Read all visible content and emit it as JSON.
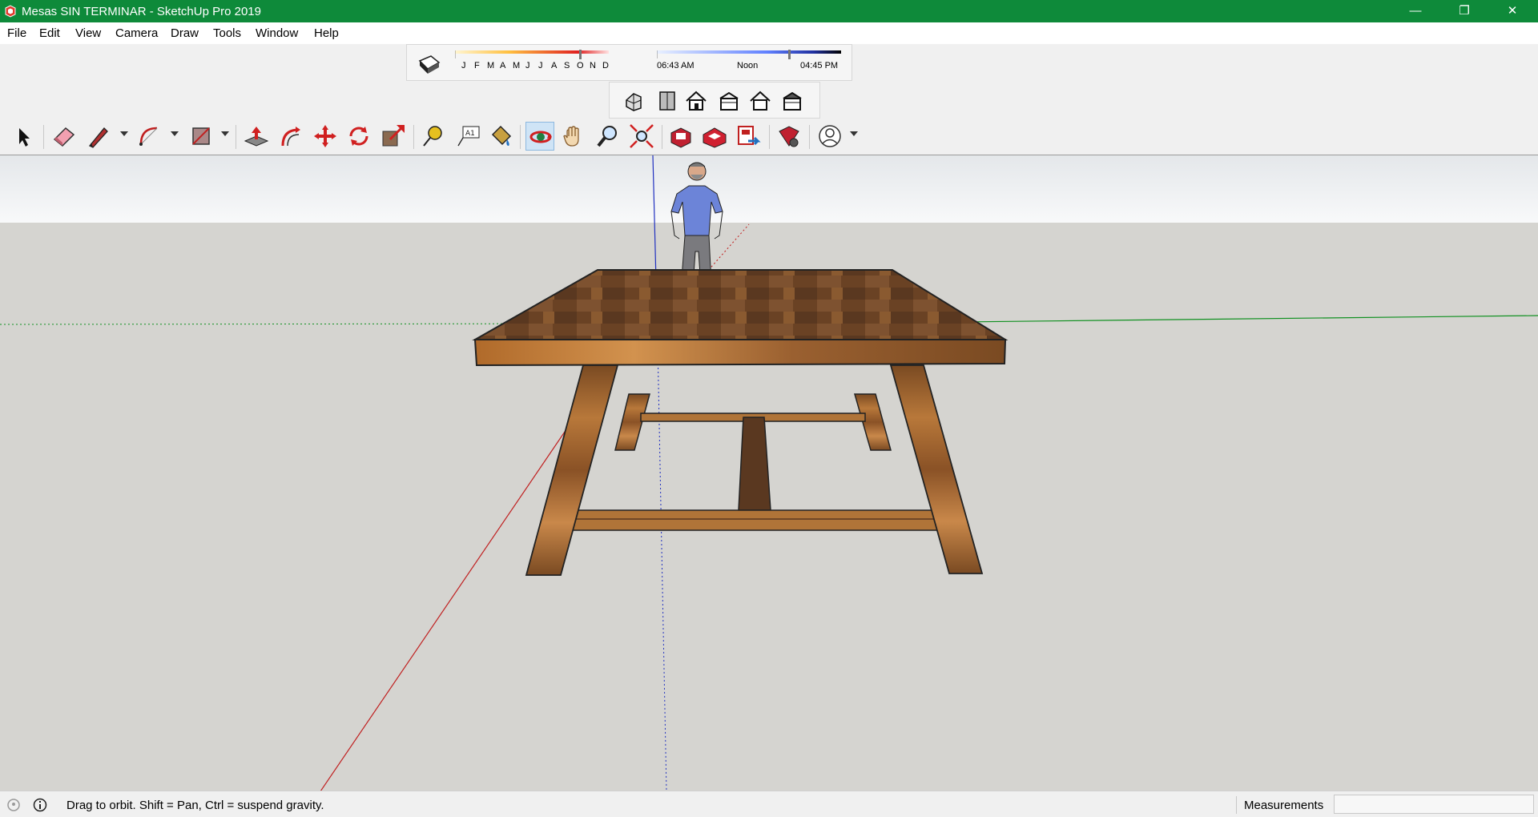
{
  "window": {
    "title": "Mesas SIN TERMINAR - SketchUp Pro 2019",
    "minimize_glyph": "—",
    "restore_glyph": "❐",
    "close_glyph": "✕"
  },
  "menu": {
    "items": [
      "File",
      "Edit",
      "View",
      "Camera",
      "Draw",
      "Tools",
      "Window",
      "Help"
    ]
  },
  "shadows": {
    "months": [
      "J",
      "F",
      "M",
      "A",
      "M",
      "J",
      "J",
      "A",
      "S",
      "O",
      "N",
      "D"
    ],
    "time_start": "06:43 AM",
    "time_mid": "Noon",
    "time_end": "04:45 PM"
  },
  "views_toolbar": {
    "icons": [
      "iso-view-icon",
      "top-view-icon",
      "front-view-icon",
      "right-view-icon",
      "back-view-icon",
      "left-view-icon"
    ]
  },
  "main_toolbar": {
    "tools": [
      "select-icon",
      "eraser-icon",
      "line-icon",
      "arc-icon",
      "rectangle-icon",
      "push-pull-icon",
      "offset-icon",
      "move-icon",
      "rotate-icon",
      "scale-icon",
      "tape-measure-icon",
      "text-icon",
      "paint-bucket-icon",
      "orbit-icon",
      "pan-icon",
      "zoom-icon",
      "zoom-extents-icon",
      "3d-warehouse-icon",
      "extension-warehouse-icon",
      "layout-icon",
      "extension-manager-icon",
      "account-icon"
    ],
    "active_tool": "orbit-icon"
  },
  "status": {
    "hint": "Drag to orbit. Shift = Pan, Ctrl = suspend gravity.",
    "measurements_label": "Measurements",
    "measurements_value": ""
  },
  "colors": {
    "titlebar": "#0e8a3a",
    "sky": "#f3f4f5",
    "ground": "#d5d4d0",
    "wood_dark": "#5a3a1e",
    "wood_light": "#b06a2a"
  }
}
